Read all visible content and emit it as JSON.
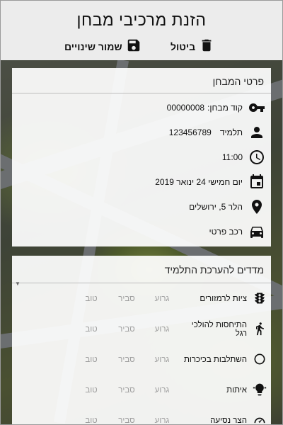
{
  "header": {
    "title": "הזנת מרכיבי מבחן",
    "cancel_label": "ביטול",
    "save_label": "שמור שינויים"
  },
  "exam_details": {
    "title": "פרטי המבחן",
    "exam_code_label": "קוד מבחן:",
    "exam_code": "00000008",
    "student_label": "תלמיד",
    "student_id": "123456789",
    "time": "11:00",
    "date": "יום חמישי 24 ינואר 2019",
    "location": "הלר 5, ירושלים",
    "vehicle": "רכב פרטי"
  },
  "criteria": {
    "title": "מדדים להערכת התלמיד",
    "options": [
      "גרוע",
      "סביר",
      "טוב"
    ],
    "items": [
      {
        "name": "ציות לרמזורים",
        "icon": "traffic-light-icon"
      },
      {
        "name": "התיחסות להולכי רגל",
        "icon": "pedestrian-icon"
      },
      {
        "name": "השתלבות בכיכרות",
        "icon": "roundabout-icon"
      },
      {
        "name": "איתות",
        "icon": "signal-icon"
      },
      {
        "name": "הצר נסיעה",
        "icon": "speedometer-icon"
      }
    ]
  }
}
